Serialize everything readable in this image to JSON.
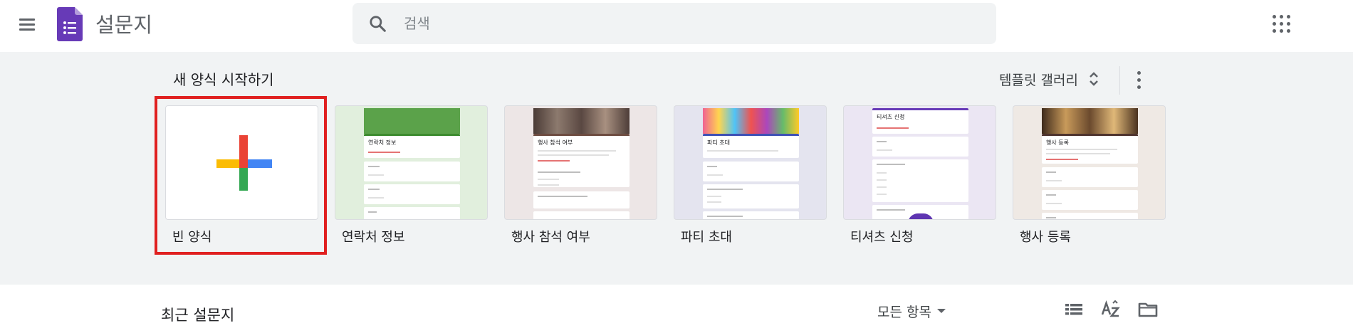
{
  "header": {
    "app_title": "설문지",
    "search_placeholder": "검색"
  },
  "gallery": {
    "title": "새 양식 시작하기",
    "toggle_label": "템플릿 갤러리",
    "templates": [
      {
        "name": "빈 양식",
        "thumb_title": ""
      },
      {
        "name": "연락처 정보",
        "thumb_title": "연락처 정보"
      },
      {
        "name": "행사 참석 여부",
        "thumb_title": "행사 참석 여부"
      },
      {
        "name": "파티 초대",
        "thumb_title": "파티 초대"
      },
      {
        "name": "티셔츠 신청",
        "thumb_title": "티셔츠 신청"
      },
      {
        "name": "행사 등록",
        "thumb_title": "행사 등록"
      }
    ]
  },
  "recent": {
    "title": "최근 설문지",
    "owner_filter": "모든 항목"
  },
  "colors": {
    "forms_purple": "#673ab7",
    "gallery_bg": "#f1f3f4",
    "highlight_red": "#e02020",
    "plus_red": "#ea4335",
    "plus_blue": "#4285f4",
    "plus_yellow": "#fbbc04",
    "plus_green": "#34a853"
  }
}
